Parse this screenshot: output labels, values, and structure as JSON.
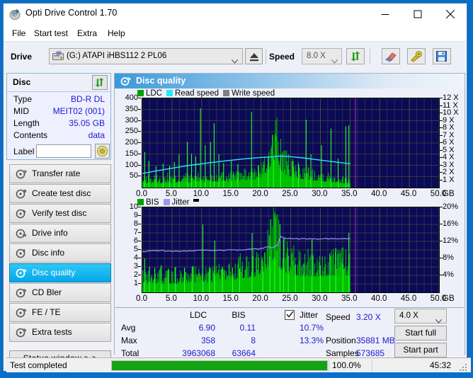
{
  "window": {
    "title": "Opti Drive Control 1.70",
    "icon": "disc-icon",
    "minimize": "–",
    "maximize": "□",
    "close": "✕"
  },
  "menu": {
    "items": [
      "File",
      "Start test",
      "Extra",
      "Help"
    ]
  },
  "toolbar": {
    "drive_label": "Drive",
    "drive_value": "(G:)  ATAPI iHBS112  2 PL06",
    "eject_icon": "eject-icon",
    "speed_label": "Speed",
    "speed_value": "8.0 X",
    "refresh_icon": "refresh-icon",
    "erase_icon": "eraser-icon",
    "tools_icon": "tools-icon",
    "save_icon": "save-icon"
  },
  "disc_panel": {
    "title": "Disc",
    "refresh_icon": "refresh-icon",
    "rows": [
      {
        "key": "Type",
        "value": "BD-R DL"
      },
      {
        "key": "MID",
        "value": "MEIT02 (001)"
      },
      {
        "key": "Length",
        "value": "35.05 GB"
      },
      {
        "key": "Contents",
        "value": "data"
      }
    ],
    "label_key": "Label",
    "label_value": "",
    "label_placeholder": "",
    "label_button_icon": "cd-disc-icon"
  },
  "nav": {
    "items": [
      {
        "label": "Transfer rate",
        "icon": "disc-speed-icon",
        "selected": false
      },
      {
        "label": "Create test disc",
        "icon": "disc-write-icon",
        "selected": false
      },
      {
        "label": "Verify test disc",
        "icon": "disc-verify-icon",
        "selected": false
      },
      {
        "label": "Drive info",
        "icon": "drive-info-icon",
        "selected": false
      },
      {
        "label": "Disc info",
        "icon": "disc-info-icon",
        "selected": false
      },
      {
        "label": "Disc quality",
        "icon": "disc-quality-icon",
        "selected": true
      },
      {
        "label": "CD Bler",
        "icon": "cd-bler-icon",
        "selected": false
      },
      {
        "label": "FE / TE",
        "icon": "fe-te-icon",
        "selected": false
      },
      {
        "label": "Extra tests",
        "icon": "extra-tests-icon",
        "selected": false
      }
    ],
    "status_window": "Status window > >"
  },
  "panel": {
    "title": "Disc quality",
    "icon": "disc-quality-icon"
  },
  "stats": {
    "col_ldc": "LDC",
    "col_bis": "BIS",
    "jitter_label": "Jitter",
    "jitter_checked": true,
    "rows": [
      {
        "label": "Avg",
        "ldc": "6.90",
        "bis": "0.11",
        "jitter": "10.7%"
      },
      {
        "label": "Max",
        "ldc": "358",
        "bis": "8",
        "jitter": "13.3%"
      },
      {
        "label": "Total",
        "ldc": "3963068",
        "bis": "63664",
        "jitter": ""
      }
    ],
    "speed_label": "Speed",
    "speed_value": "3.20 X",
    "position_label": "Position",
    "position_value": "35881 MB",
    "samples_label": "Samples",
    "samples_value": "573685",
    "speed_select": "4.0 X",
    "start_full": "Start full",
    "start_part": "Start part"
  },
  "statusbar": {
    "text": "Test completed",
    "progress_pct": 100.0,
    "progress_text": "100.0%",
    "time": "45:32"
  },
  "colors": {
    "ldc_green": "#00a000",
    "bis_green": "#00a000",
    "read_speed_cyan": "#25e8ff",
    "write_speed_gray": "#808080",
    "jitter_lilac": "#9a9aee",
    "plot_bg": "#0a0a55",
    "selection_blue": "#04a7e8",
    "value_blue": "#1a1ad0",
    "progress_green": "#13a313"
  },
  "chart_data": [
    {
      "type": "area",
      "name": "disc-quality-ldc",
      "title": "",
      "xlabel": "GB",
      "ylabel": "",
      "xlim": [
        0,
        50
      ],
      "ylim": [
        0,
        400
      ],
      "y2lim": [
        0,
        12
      ],
      "y2label": "X",
      "grid": true,
      "legend_position": "top-left",
      "legend": [
        "LDC",
        "Read speed",
        "Write speed"
      ],
      "xticks": [
        "0.0",
        "5.0",
        "10.0",
        "15.0",
        "20.0",
        "25.0",
        "30.0",
        "35.0",
        "40.0",
        "45.0",
        "50.0"
      ],
      "yticks": [
        50,
        100,
        150,
        200,
        250,
        300,
        350,
        400
      ],
      "y2ticks": [
        "1 X",
        "2 X",
        "3 X",
        "4 X",
        "5 X",
        "6 X",
        "7 X",
        "8 X",
        "9 X",
        "10 X",
        "11 X",
        "12 X"
      ],
      "data_end_gb": 35.05,
      "marker_line_gb": 35.9,
      "series": [
        {
          "name": "LDC",
          "color": "#00c000",
          "type": "spikes",
          "x_step_gb": 0.12,
          "baseline": [
            18,
            20,
            22,
            20,
            19,
            21,
            23,
            20,
            18,
            19,
            22,
            25,
            24,
            22,
            20,
            21,
            23,
            22,
            24,
            26,
            25,
            23,
            22,
            24,
            26,
            25,
            27,
            26,
            24,
            23,
            25,
            27,
            26,
            28,
            27,
            26,
            28,
            30,
            29,
            27,
            28,
            30,
            32,
            30,
            29,
            31,
            33,
            32,
            30,
            32,
            34,
            36,
            38,
            40,
            45,
            52,
            60,
            72,
            88,
            105,
            125,
            118,
            100,
            84,
            70,
            62,
            56,
            52,
            48,
            46,
            44,
            42,
            40,
            38,
            37,
            36,
            35,
            34,
            33,
            32,
            31,
            30,
            29,
            28,
            27,
            26,
            25,
            24,
            23,
            22,
            21,
            20,
            19,
            18,
            18,
            17
          ],
          "spikes": [
            {
              "gb": 0.4,
              "v": 160
            },
            {
              "gb": 1.1,
              "v": 120
            },
            {
              "gb": 2.3,
              "v": 95
            },
            {
              "gb": 3.5,
              "v": 108
            },
            {
              "gb": 4.6,
              "v": 98
            },
            {
              "gb": 5.4,
              "v": 115
            },
            {
              "gb": 6.2,
              "v": 150
            },
            {
              "gb": 7.6,
              "v": 205
            },
            {
              "gb": 8.3,
              "v": 152
            },
            {
              "gb": 9.0,
              "v": 140
            },
            {
              "gb": 9.8,
              "v": 355
            },
            {
              "gb": 10.6,
              "v": 190
            },
            {
              "gb": 11.5,
              "v": 205
            },
            {
              "gb": 12.1,
              "v": 288
            },
            {
              "gb": 12.9,
              "v": 150
            },
            {
              "gb": 13.7,
              "v": 110
            },
            {
              "gb": 15.0,
              "v": 120
            },
            {
              "gb": 16.1,
              "v": 105
            },
            {
              "gb": 18.4,
              "v": 340
            },
            {
              "gb": 19.6,
              "v": 100
            },
            {
              "gb": 21.2,
              "v": 140
            },
            {
              "gb": 22.1,
              "v": 135
            },
            {
              "gb": 23.3,
              "v": 145
            },
            {
              "gb": 25.4,
              "v": 120
            },
            {
              "gb": 26.3,
              "v": 110
            },
            {
              "gb": 27.6,
              "v": 305
            },
            {
              "gb": 28.4,
              "v": 150
            },
            {
              "gb": 30.2,
              "v": 190
            },
            {
              "gb": 31.8,
              "v": 265
            },
            {
              "gb": 33.0,
              "v": 130
            },
            {
              "gb": 34.3,
              "v": 275
            },
            {
              "gb": 34.8,
              "v": 278
            }
          ]
        },
        {
          "name": "Read speed",
          "color": "#25e8ff",
          "type": "line",
          "axis": "right",
          "points": [
            {
              "gb": 0.0,
              "x": 1.9
            },
            {
              "gb": 2.0,
              "x": 2.2
            },
            {
              "gb": 5.0,
              "x": 2.6
            },
            {
              "gb": 8.0,
              "x": 3.0
            },
            {
              "gb": 11.0,
              "x": 3.3
            },
            {
              "gb": 14.0,
              "x": 3.6
            },
            {
              "gb": 17.0,
              "x": 3.85
            },
            {
              "gb": 20.0,
              "x": 4.05
            },
            {
              "gb": 22.0,
              "x": 4.15
            },
            {
              "gb": 23.2,
              "x": 4.25
            },
            {
              "gb": 24.5,
              "x": 4.2
            },
            {
              "gb": 27.0,
              "x": 4.0
            },
            {
              "gb": 30.0,
              "x": 3.7
            },
            {
              "gb": 33.0,
              "x": 3.4
            },
            {
              "gb": 35.05,
              "x": 3.2
            }
          ]
        },
        {
          "name": "Write speed",
          "color": "#808080",
          "type": "line",
          "points": []
        }
      ]
    },
    {
      "type": "area",
      "name": "disc-quality-bis-jitter",
      "title": "",
      "xlabel": "GB",
      "ylabel": "",
      "xlim": [
        0,
        50
      ],
      "ylim": [
        0,
        10
      ],
      "y2lim": [
        0,
        20
      ],
      "y2label": "%",
      "grid": true,
      "legend_position": "top-left",
      "legend": [
        "BIS",
        "Jitter"
      ],
      "xticks": [
        "0.0",
        "5.0",
        "10.0",
        "15.0",
        "20.0",
        "25.0",
        "30.0",
        "35.0",
        "40.0",
        "45.0",
        "50.0"
      ],
      "yticks": [
        1,
        2,
        3,
        4,
        5,
        6,
        7,
        8,
        9,
        10
      ],
      "y2ticks": [
        "4%",
        "8%",
        "12%",
        "16%",
        "20%"
      ],
      "data_end_gb": 35.05,
      "marker_line_gb": 35.9,
      "series": [
        {
          "name": "BIS",
          "color": "#00c000",
          "type": "spikes",
          "baseline": [
            1.0,
            1.1,
            1.0,
            1.2,
            1.0,
            1.1,
            1.0,
            1.0,
            1.2,
            1.0,
            1.1,
            1.0,
            1.2,
            1.1,
            1.0,
            1.1,
            1.3,
            1.2,
            1.1,
            1.2,
            1.3,
            1.2,
            1.1,
            1.3,
            1.4,
            1.3,
            1.4,
            1.5,
            1.4,
            1.6,
            1.5,
            1.7,
            1.6,
            1.8,
            1.7,
            1.9,
            1.8,
            2.0,
            2.2,
            2.4,
            2.8,
            3.4,
            3.9,
            3.6,
            3.0,
            2.6,
            2.4,
            2.2,
            2.1,
            2.0,
            2.0,
            1.9,
            1.9,
            1.9,
            1.9,
            1.9,
            1.9,
            1.9,
            1.9,
            1.9,
            2.0,
            2.0,
            2.0,
            2.0,
            2.0,
            2.0,
            2.0,
            2.0
          ],
          "spikes": [
            {
              "gb": 0.4,
              "v": 4.0
            },
            {
              "gb": 1.2,
              "v": 3.0
            },
            {
              "gb": 2.1,
              "v": 2.9
            },
            {
              "gb": 3.2,
              "v": 3.2
            },
            {
              "gb": 4.4,
              "v": 2.8
            },
            {
              "gb": 5.6,
              "v": 3.0
            },
            {
              "gb": 7.1,
              "v": 2.9
            },
            {
              "gb": 8.4,
              "v": 3.0
            },
            {
              "gb": 10.2,
              "v": 8.0
            },
            {
              "gb": 11.3,
              "v": 2.9
            },
            {
              "gb": 12.2,
              "v": 6.1
            },
            {
              "gb": 13.5,
              "v": 3.0
            },
            {
              "gb": 15.2,
              "v": 2.9
            },
            {
              "gb": 16.4,
              "v": 2.8
            },
            {
              "gb": 18.5,
              "v": 7.0
            },
            {
              "gb": 20.3,
              "v": 3.0
            },
            {
              "gb": 21.5,
              "v": 4.2
            },
            {
              "gb": 22.3,
              "v": 4.1
            },
            {
              "gb": 23.2,
              "v": 8.0
            },
            {
              "gb": 23.8,
              "v": 6.3
            },
            {
              "gb": 24.6,
              "v": 4.3
            },
            {
              "gb": 25.8,
              "v": 3.3
            },
            {
              "gb": 27.2,
              "v": 3.4
            },
            {
              "gb": 28.6,
              "v": 6.2
            },
            {
              "gb": 30.0,
              "v": 3.2
            },
            {
              "gb": 31.6,
              "v": 4.6
            },
            {
              "gb": 32.6,
              "v": 5.2
            },
            {
              "gb": 33.8,
              "v": 3.3
            },
            {
              "gb": 34.8,
              "v": 7.0
            }
          ]
        },
        {
          "name": "Jitter",
          "color": "#9a9aee",
          "type": "line",
          "axis": "right",
          "points": [
            {
              "gb": 0.0,
              "pct": 9.6
            },
            {
              "gb": 2.0,
              "pct": 9.9
            },
            {
              "gb": 5.0,
              "pct": 9.7
            },
            {
              "gb": 8.0,
              "pct": 9.8
            },
            {
              "gb": 11.0,
              "pct": 9.9
            },
            {
              "gb": 14.0,
              "pct": 9.9
            },
            {
              "gb": 17.0,
              "pct": 10.0
            },
            {
              "gb": 19.5,
              "pct": 10.2
            },
            {
              "gb": 21.0,
              "pct": 10.7
            },
            {
              "gb": 22.0,
              "pct": 10.5
            },
            {
              "gb": 22.8,
              "pct": 11.0
            },
            {
              "gb": 23.3,
              "pct": 13.2
            },
            {
              "gb": 24.0,
              "pct": 12.7
            },
            {
              "gb": 27.0,
              "pct": 12.6
            },
            {
              "gb": 31.0,
              "pct": 12.6
            },
            {
              "gb": 35.05,
              "pct": 12.7
            }
          ]
        }
      ]
    }
  ]
}
